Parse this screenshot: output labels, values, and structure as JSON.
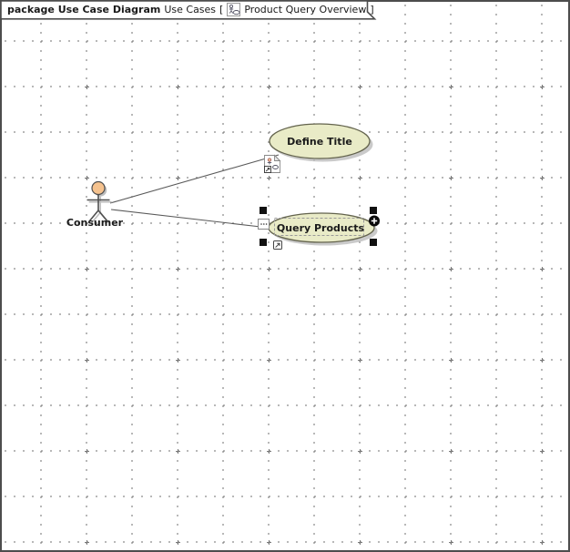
{
  "header": {
    "keyword_and_package": "package Use Case Diagram",
    "context_label": "Use Cases",
    "bracket_open": "[",
    "bracket_close": "]",
    "diagram_name": "Product Query Overview",
    "diagram_icon": "use-case-diagram-icon"
  },
  "actor": {
    "name": "Consumer"
  },
  "use_cases": [
    {
      "label": "Define Title",
      "selected": false,
      "decorator_icon": "attached-diagram-page-icon"
    },
    {
      "label": "Query Products",
      "selected": true
    }
  ],
  "relations": [
    {
      "from": "Consumer",
      "to": "Define Title",
      "type": "association"
    },
    {
      "from": "Consumer",
      "to": "Query Products",
      "type": "association"
    }
  ],
  "selection": {
    "selected_element": "Query Products",
    "handle_count": 4,
    "buttons": [
      "ellipsis-button",
      "plus-circle-button",
      "navigate-arrow-button"
    ]
  },
  "colors": {
    "use_case_fill": "#e9ebc7",
    "use_case_border": "#63634d",
    "actor_head_fill": "#f5c28e",
    "frame_border": "#4d4d4d",
    "grid_dot": "#8c8c8c",
    "selection_handle": "#111111"
  }
}
